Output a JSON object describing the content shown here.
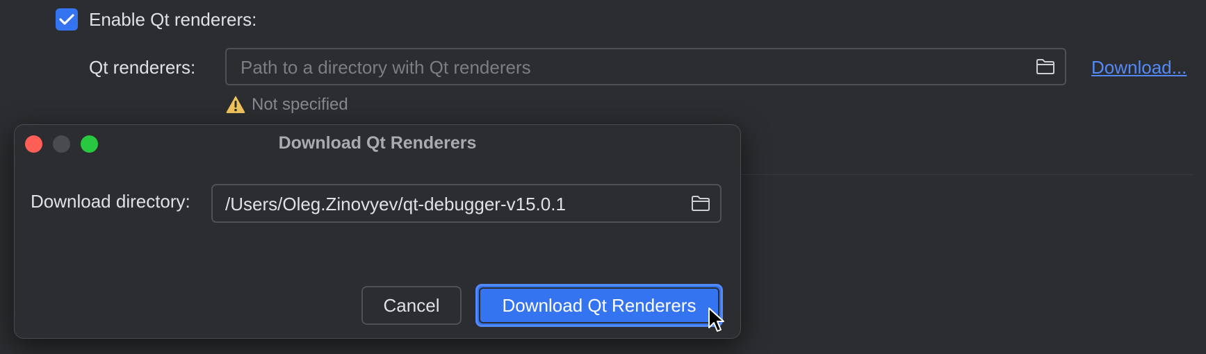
{
  "settings": {
    "enable_label": "Enable Qt renderers:",
    "enable_checked": true,
    "renderers_label": "Qt renderers:",
    "renderers_placeholder": "Path to a directory with Qt renderers",
    "download_link": "Download...",
    "warning_text": "Not specified"
  },
  "dialog": {
    "title": "Download Qt Renderers",
    "directory_label": "Download directory:",
    "directory_value": "/Users/Oleg.Zinovyev/qt-debugger-v15.0.1",
    "cancel_label": "Cancel",
    "confirm_label": "Download Qt Renderers"
  },
  "colors": {
    "accent": "#3574f0",
    "link": "#548af7",
    "warning": "#f2c55c",
    "background": "#2b2d30"
  },
  "icons": {
    "checkbox": "checkmark-icon",
    "folder": "folder-icon",
    "warning": "warning-icon",
    "cursor": "mouse-pointer-icon"
  }
}
